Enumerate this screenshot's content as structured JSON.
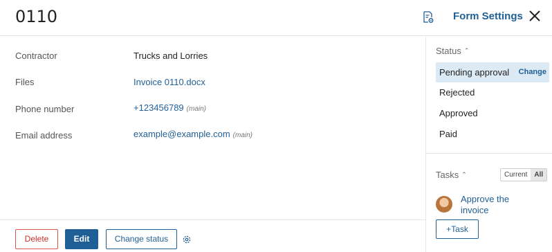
{
  "header": {
    "title": "0110",
    "form_settings_label": "Form Settings"
  },
  "fields": [
    {
      "label": "Contractor",
      "value": "Trucks and Lorries",
      "tag": ""
    },
    {
      "label": "Files",
      "value": "Invoice 0110.docx",
      "tag": ""
    },
    {
      "label": "Phone number",
      "value": "+123456789",
      "tag": "(main)"
    },
    {
      "label": "Email address",
      "value": "example@example.com",
      "tag": "(main)"
    }
  ],
  "footer": {
    "delete_label": "Delete",
    "edit_label": "Edit",
    "change_status_label": "Change status"
  },
  "status": {
    "heading": "Status",
    "items": [
      "Pending approval",
      "Rejected",
      "Approved",
      "Paid"
    ],
    "active_index": 0,
    "change_label": "Change"
  },
  "tasks": {
    "heading": "Tasks",
    "filter_current": "Current",
    "filter_all": "All",
    "selected_filter": "All",
    "task_title": "Approve the invoice",
    "add_task_label": "Task"
  },
  "colors": {
    "accent": "#1f5f96",
    "danger": "#c9302c",
    "active_bg": "#dceaf6"
  },
  "icons": [
    "form-settings-icon",
    "close-icon",
    "gear-icon",
    "chevron-up-icon",
    "plus-icon",
    "avatar"
  ]
}
